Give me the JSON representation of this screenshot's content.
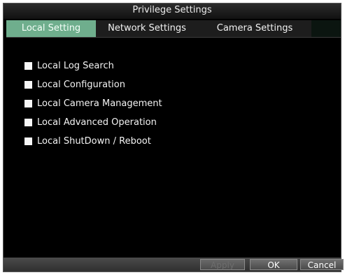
{
  "dialog": {
    "title": "Privilege Settings",
    "tabs": [
      "Local Setting",
      "Network Settings",
      "Camera Settings"
    ],
    "items": [
      {
        "label": "Local Log Search",
        "checked": false
      },
      {
        "label": "Local Configuration",
        "checked": false
      },
      {
        "label": "Local Camera Management",
        "checked": false
      },
      {
        "label": "Local Advanced Operation",
        "checked": false
      },
      {
        "label": "Local ShutDown / Reboot",
        "checked": false
      }
    ],
    "buttons": {
      "apply": "Apply",
      "ok": "OK",
      "cancel": "Cancel"
    }
  },
  "colors": {
    "active_tab": "#6fae8d",
    "background": "#000000"
  }
}
